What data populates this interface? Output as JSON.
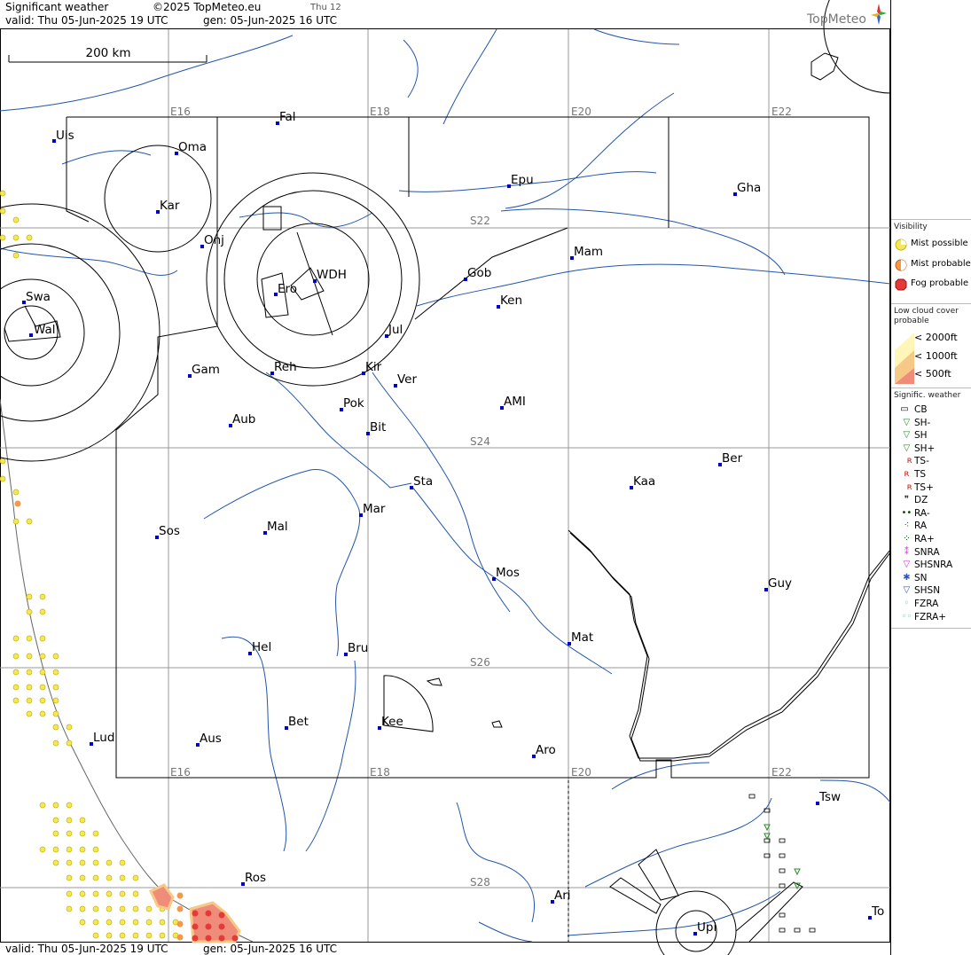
{
  "header": {
    "title": "Significant weather",
    "copyright": "©2025 TopMeteo.eu",
    "day_tag": "Thu 12",
    "valid": "valid:  Thu  05-Jun-2025  19 UTC",
    "generated": "gen: 05-Jun-2025 16 UTC",
    "brand": "TopMeteo"
  },
  "footer": {
    "valid": "valid:  Thu  05-Jun-2025  19 UTC",
    "generated": "gen: 05-Jun-2025 16 UTC"
  },
  "scale_bar": {
    "label": "200 km"
  },
  "grid_labels": {
    "E16_top": "E16",
    "E18_top": "E18",
    "E20_top": "E20",
    "E22_top": "E22",
    "E16_bot": "E16",
    "E18_bot": "E18",
    "E20_bot": "E20",
    "E22_bot": "E22",
    "S22": "S22",
    "S24": "S24",
    "S26": "S26",
    "S28": "S28"
  },
  "places": {
    "uis": "Uis",
    "fal": "Fal",
    "oma": "Oma",
    "kar": "Kar",
    "onj": "Onj",
    "epu": "Epu",
    "gha": "Gha",
    "swa": "Swa",
    "wal": "Wal",
    "ero": "Ero",
    "wdh": "WDH",
    "gob": "Gob",
    "mam": "Mam",
    "ken": "Ken",
    "jul": "Jul",
    "gam": "Gam",
    "reh": "Reh",
    "kir": "Kir",
    "ver": "Ver",
    "pok": "Pok",
    "ami": "AMI",
    "aub": "Aub",
    "bit": "Bit",
    "ber": "Ber",
    "sta": "Sta",
    "kaa": "Kaa",
    "mar": "Mar",
    "sos": "Sos",
    "mal": "Mal",
    "mos": "Mos",
    "guy": "Guy",
    "mat": "Mat",
    "hel": "Hel",
    "bru": "Bru",
    "bet": "Bet",
    "kee": "Kee",
    "lud": "Lud",
    "aus": "Aus",
    "aro": "Aro",
    "tsw": "Tsw",
    "ros": "Ros",
    "ari": "Ari",
    "upi": "Upi",
    "to": "To"
  },
  "legend": {
    "visibility": {
      "title": "Visibility",
      "items": [
        "Mist possible",
        "Mist probable",
        "Fog probable"
      ]
    },
    "low_cloud": {
      "title": "Low cloud cover probable",
      "items": [
        "< 2000ft",
        "< 1000ft",
        "<   500ft"
      ]
    },
    "sigwx": {
      "title": "Signific. weather",
      "items": [
        "CB",
        "SH-",
        "SH",
        "SH+",
        "TS-",
        "TS",
        "TS+",
        "DZ",
        "RA-",
        "RA",
        "RA+",
        "SNRA",
        "SHSNRA",
        "SN",
        "SHSN",
        "FZRA",
        "FZRA+"
      ]
    }
  },
  "colors": {
    "river": "#2255aa",
    "grid": "#999999",
    "boundary": "#000000",
    "city": "#0000cc",
    "mist_possible": "#f4e85a",
    "mist_probable": "#f39a4a",
    "fog_probable": "#e63a3a",
    "lowcloud_2000": "#fff6b8",
    "lowcloud_1000": "#f7c987",
    "lowcloud_500": "#f08c7a",
    "shower": "#2a8a2a",
    "thunder": "#cc2222",
    "drizzle": "#114411",
    "snow": "#cc33cc",
    "freezing": "#33cccc"
  }
}
